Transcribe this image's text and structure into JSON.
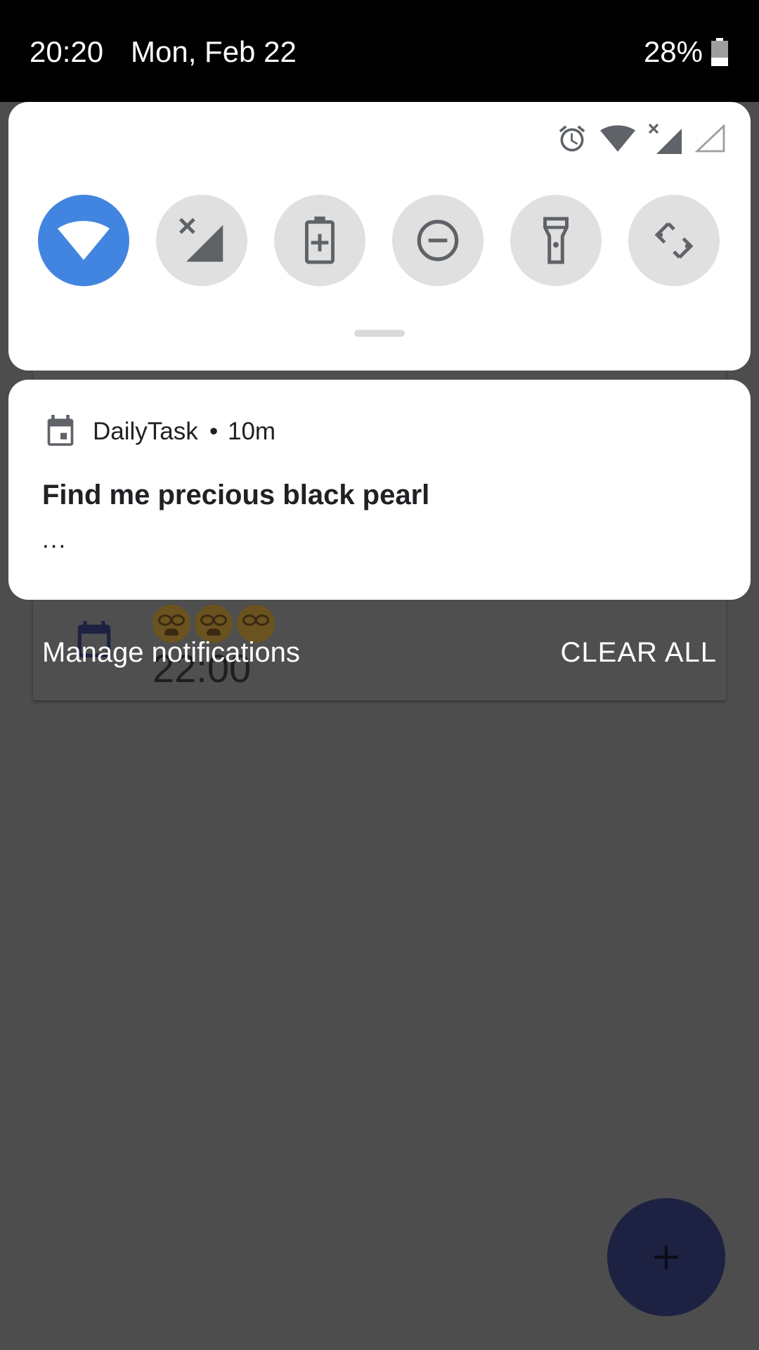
{
  "status_bar": {
    "time": "20:20",
    "date": "Mon, Feb 22",
    "battery": "28%"
  },
  "quick_settings": {
    "status_icons": [
      "alarm-icon",
      "wifi-icon",
      "mobile-signal-no-data-icon",
      "signal-empty-icon"
    ],
    "tiles": [
      {
        "name": "wifi",
        "icon": "wifi-icon",
        "active": true
      },
      {
        "name": "mobile-data",
        "icon": "mobile-data-off-icon",
        "active": false
      },
      {
        "name": "battery-saver",
        "icon": "battery-saver-icon",
        "active": false
      },
      {
        "name": "do-not-disturb",
        "icon": "do-not-disturb-icon",
        "active": false
      },
      {
        "name": "flashlight",
        "icon": "flashlight-icon",
        "active": false
      },
      {
        "name": "auto-rotate",
        "icon": "auto-rotate-icon",
        "active": false
      }
    ],
    "accent_color": "#4285e0"
  },
  "notification": {
    "app_name": "DailyTask",
    "separator": "•",
    "time_ago": "10m",
    "title": "Find me precious black pearl",
    "text": "...",
    "icon": "calendar-icon"
  },
  "footer": {
    "manage_label": "Manage notifications",
    "clear_all_label": "CLEAR ALL"
  },
  "background_app": {
    "task_time": "22:00",
    "fab_icon": "plus-icon"
  }
}
